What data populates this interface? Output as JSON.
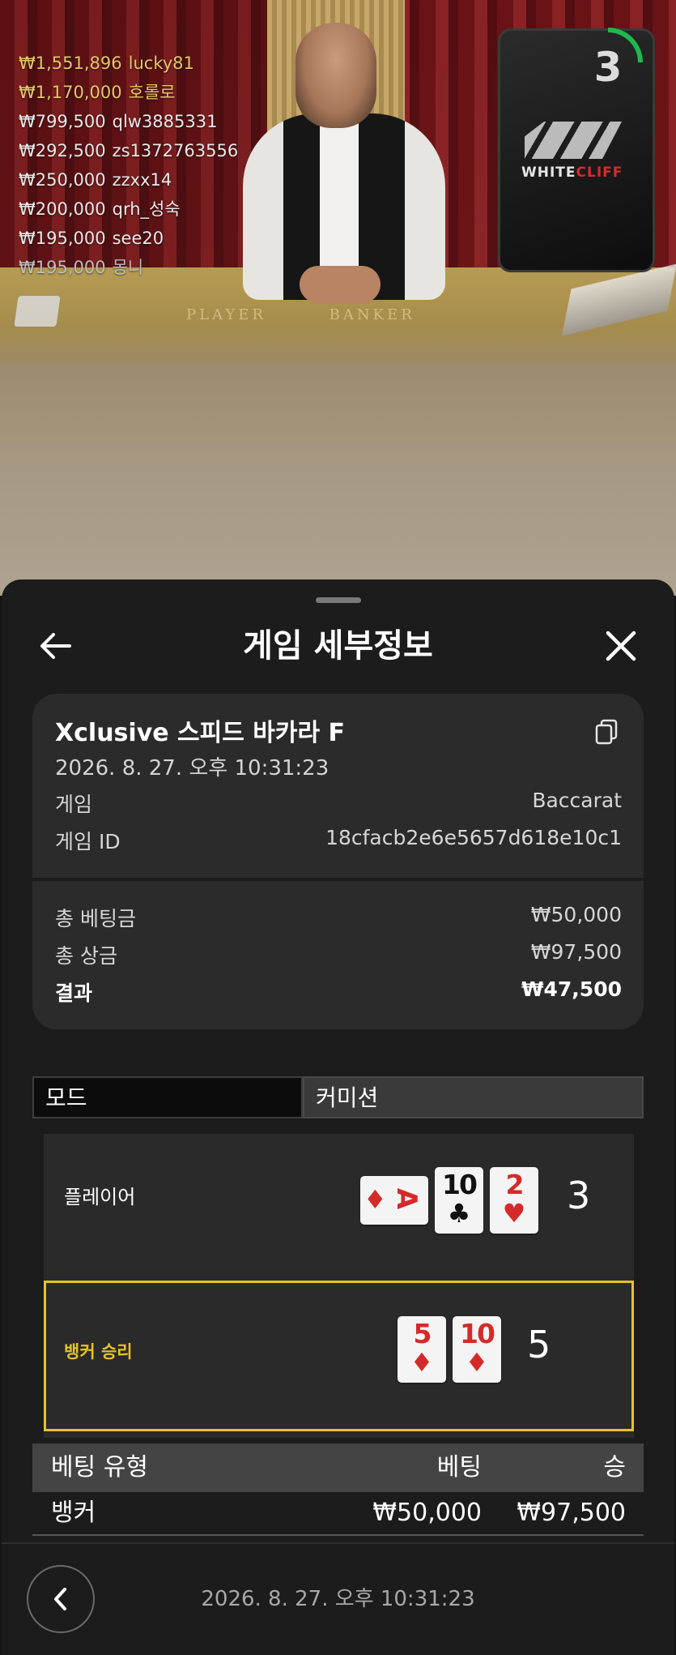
{
  "video": {
    "countdown": "3",
    "monitor_brand": "WHITE",
    "monitor_brand_accent": "CLIFF",
    "table_text": "PLAYER        BANKER",
    "winners": [
      {
        "amount": "₩1,551,896",
        "user": "lucky81",
        "color": "#e2c86a"
      },
      {
        "amount": "₩1,170,000",
        "user": "호롤로",
        "color": "#e2c86a"
      },
      {
        "amount": "₩799,500",
        "user": "qlw3885331",
        "color": "#e8e8e8"
      },
      {
        "amount": "₩292,500",
        "user": "zs1372763556",
        "color": "#e8e8e8"
      },
      {
        "amount": "₩250,000",
        "user": "zzxx14",
        "color": "#e8e8e8"
      },
      {
        "amount": "₩200,000",
        "user": "qrh_성숙",
        "color": "#e8e8e8"
      },
      {
        "amount": "₩195,000",
        "user": "see20",
        "color": "#e8e8e8"
      },
      {
        "amount": "₩195,000",
        "user": "몽니",
        "color": "#bdbdbd"
      }
    ]
  },
  "header": {
    "title": "게임 세부정보",
    "back_icon": "arrow-left-icon",
    "close_icon": "close-icon"
  },
  "details": {
    "game_name": "Xclusive 스피드 바카라 F",
    "datetime": "2026. 8. 27. 오후 10:31:23",
    "game_label": "게임",
    "game_value": "Baccarat",
    "game_id_label": "게임 ID",
    "game_id_value": "18cfacb2e6e5657d618e10c1",
    "total_bet_label": "총 베팅금",
    "total_bet_value": "₩50,000",
    "total_win_label": "총 상금",
    "total_win_value": "₩97,500",
    "result_label": "결과",
    "result_value": "₩47,500"
  },
  "tabs": {
    "mode": "모드",
    "commission": "커미션"
  },
  "result": {
    "player_label": "플레이어",
    "player_score": "3",
    "player_cards": [
      {
        "rank": "A",
        "suit": "♦",
        "color": "red",
        "sideways": true
      },
      {
        "rank": "10",
        "suit": "♣",
        "color": "black",
        "sideways": false
      },
      {
        "rank": "2",
        "suit": "♥",
        "color": "red",
        "sideways": false
      }
    ],
    "banker_label": "뱅커 승리",
    "banker_score": "5",
    "banker_cards": [
      {
        "rank": "5",
        "suit": "♦",
        "color": "red",
        "sideways": false
      },
      {
        "rank": "10",
        "suit": "♦",
        "color": "red",
        "sideways": false
      }
    ],
    "highlight_color": "#e6c229"
  },
  "bets": {
    "headers": {
      "type": "베팅 유형",
      "bet": "베팅",
      "win": "승"
    },
    "rows": [
      {
        "type": "뱅커",
        "bet": "₩50,000",
        "win": "₩97,500"
      }
    ]
  },
  "footer": {
    "datetime": "2026. 8. 27. 오후 10:31:23"
  }
}
